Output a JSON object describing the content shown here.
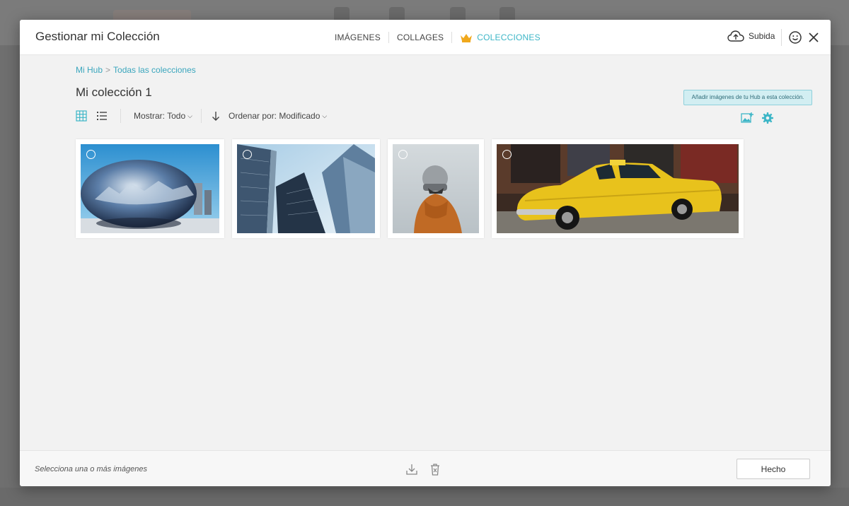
{
  "modal": {
    "title": "Gestionar mi Colección"
  },
  "tabs": [
    {
      "label": "IMÁGENES"
    },
    {
      "label": "COLLAGES"
    },
    {
      "label": "COLECCIONES",
      "active": true
    }
  ],
  "header": {
    "upload_label": "Subida"
  },
  "breadcrumb": {
    "root": "Mi Hub",
    "separator": ">",
    "current": "Todas las colecciones"
  },
  "collection": {
    "title": "Mi colección 1"
  },
  "toolbar": {
    "show_label": "Mostrar: Todo",
    "sort_label": "Ordenar por: Modificado"
  },
  "add_hint": "Añadir imágenes de tu Hub a esta colección.",
  "images": [
    {
      "name": "cloud-gate-bean"
    },
    {
      "name": "skyscrapers-looking-up"
    },
    {
      "name": "person-orange-jacket"
    },
    {
      "name": "yellow-taxi-car"
    }
  ],
  "footer": {
    "hint": "Selecciona una o más imágenes",
    "done_label": "Hecho"
  },
  "colors": {
    "accent": "#3db6c7",
    "crown": "#f0a81c"
  }
}
